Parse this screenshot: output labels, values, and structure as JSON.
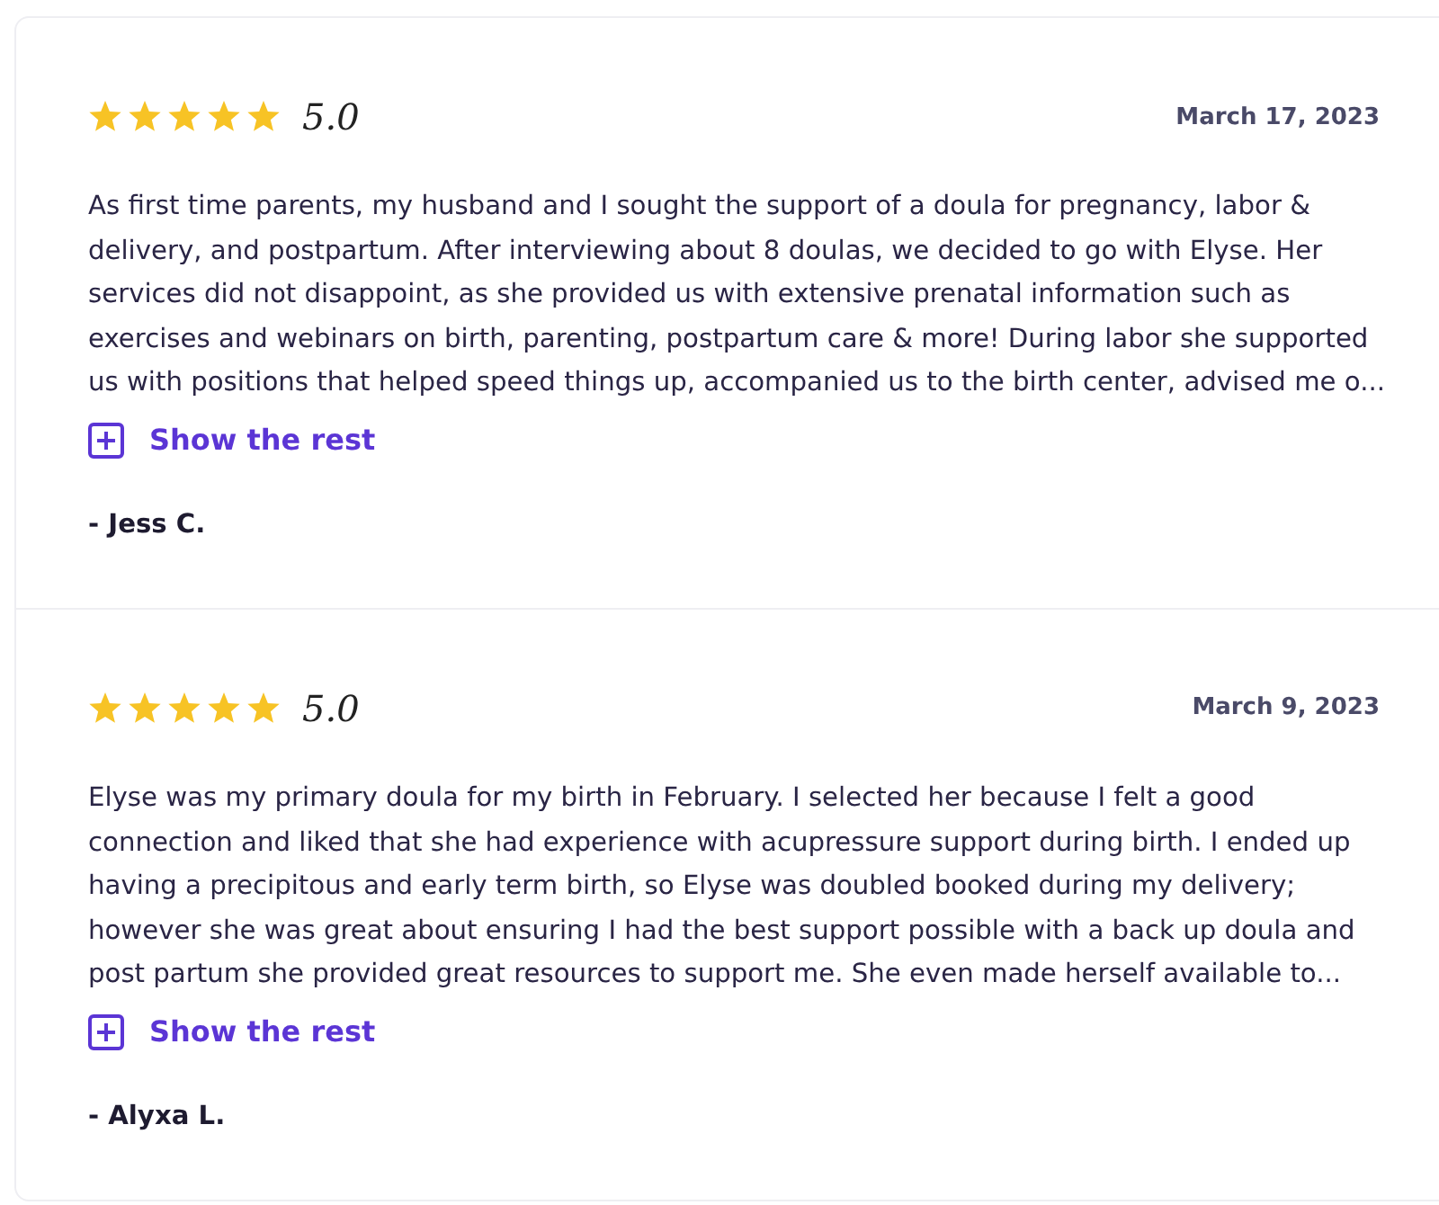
{
  "reviews": [
    {
      "stars": 5,
      "rating": "5.0",
      "date": "March 17, 2023",
      "lines": [
        "As first time parents, my husband and I sought the support of a doula for pregnancy, labor &",
        "delivery, and postpartum. After interviewing about 8 doulas, we decided to go with Elyse. Her",
        "services did not disappoint, as she provided us with extensive prenatal information such as",
        "exercises and webinars on birth, parenting, postpartum care & more! During labor she supported",
        "us with positions that helped speed things up, accompanied us to the birth center, advised me o..."
      ],
      "more": "Show the rest",
      "author": "- Jess C."
    },
    {
      "stars": 5,
      "rating": "5.0",
      "date": "March 9, 2023",
      "lines": [
        "Elyse was my primary doula for my birth in February. I selected her because I felt a good",
        "connection and liked that she had experience with acupressure support during birth. I ended up",
        "having a precipitous and early term birth, so Elyse was doubled booked during my delivery;",
        "however she was great about ensuring I had the best support possible with a back up doula and",
        "post partum she provided great resources to support me. She even made herself available to..."
      ],
      "more": "Show the rest",
      "author": "- Alyxa L."
    }
  ]
}
